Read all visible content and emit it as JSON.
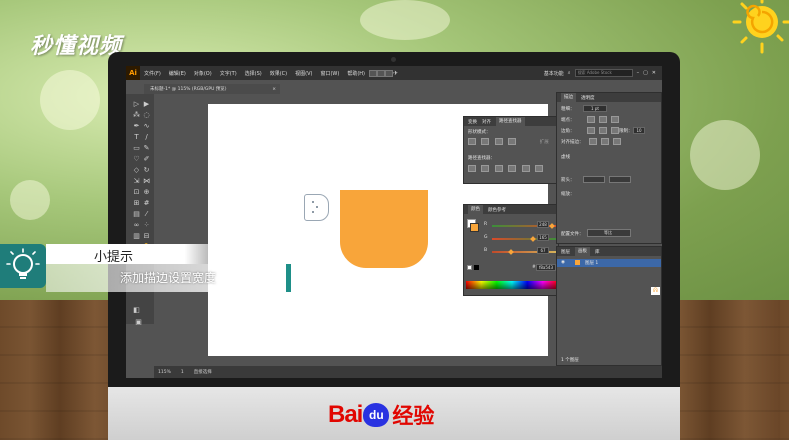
{
  "watermark": {
    "logo_text": "秒懂视频"
  },
  "illustrator": {
    "app_logo": "Ai",
    "menu": [
      "文件(F)",
      "编辑(E)",
      "对象(O)",
      "文字(T)",
      "选择(S)",
      "效果(C)",
      "视图(V)",
      "窗口(W)",
      "帮助(H)"
    ],
    "workspace_label": "基本功能",
    "search_placeholder": "搜索 Adobe Stock",
    "document_tab": "未标题-1* @ 115% (RGB/GPU 预览)",
    "zoom_level": "115%",
    "status_text": "直接选择",
    "artboard_num": "1",
    "colors": {
      "shape_fill": "#f8a53a",
      "ui_bg": "#535353"
    }
  },
  "panels": {
    "pathfinder": {
      "tabs": [
        "变换",
        "对齐",
        "路径查找器"
      ],
      "shape_modes_label": "形状模式：",
      "pathfinders_label": "路径查找器：",
      "expand_label": "扩展"
    },
    "color": {
      "tabs": [
        "颜色",
        "颜色参考"
      ],
      "r_label": "R",
      "g_label": "G",
      "b_label": "B",
      "r_value": "248",
      "g_value": "165",
      "b_value": "67",
      "hex_prefix": "#",
      "hex_value": "f8a543"
    },
    "stroke": {
      "tabs": [
        "描边",
        "透明度"
      ],
      "weight_label": "粗细：",
      "weight_value": "1 pt",
      "cap_label": "端点：",
      "corner_label": "边角：",
      "limit_label": "限制：",
      "limit_value": "10",
      "align_label": "对齐描边：",
      "dashed_label": "虚线",
      "arrow_label": "箭头：",
      "scale_label": "缩放：",
      "profile_label": "配置文件：",
      "profile_value": "等比"
    },
    "layers": {
      "tabs": [
        "图层",
        "画板",
        "库"
      ],
      "layer_name": "图层 1",
      "footer": "1 个图层"
    }
  },
  "tip": {
    "title": "小提示",
    "body": "添加描边设置宽度",
    "icon": "lightbulb-icon"
  },
  "brand": {
    "bai": "Bai",
    "du": "du",
    "jingyan": "经验"
  }
}
